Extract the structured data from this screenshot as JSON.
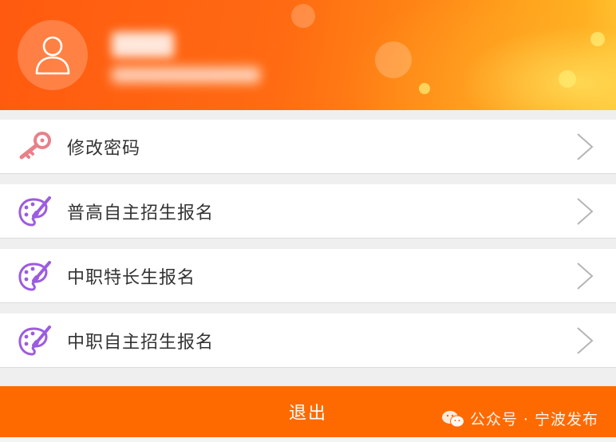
{
  "user": {
    "name_blurred": "•••",
    "sub_blurred": "••••••••••"
  },
  "menu": {
    "items": [
      {
        "label": "修改密码",
        "icon": "key-icon"
      },
      {
        "label": "普高自主招生报名",
        "icon": "palette-brush-icon"
      },
      {
        "label": "中职特长生报名",
        "icon": "palette-brush-icon"
      },
      {
        "label": "中职自主招生报名",
        "icon": "palette-brush-icon"
      }
    ]
  },
  "logout_label": "退出",
  "watermark": "公众号 · 宁波发布",
  "colors": {
    "header_orange": "#ff6a12",
    "logout_orange": "#ff6a00",
    "key_pink": "#e8808a",
    "palette_purple": "#9b5ce0"
  }
}
